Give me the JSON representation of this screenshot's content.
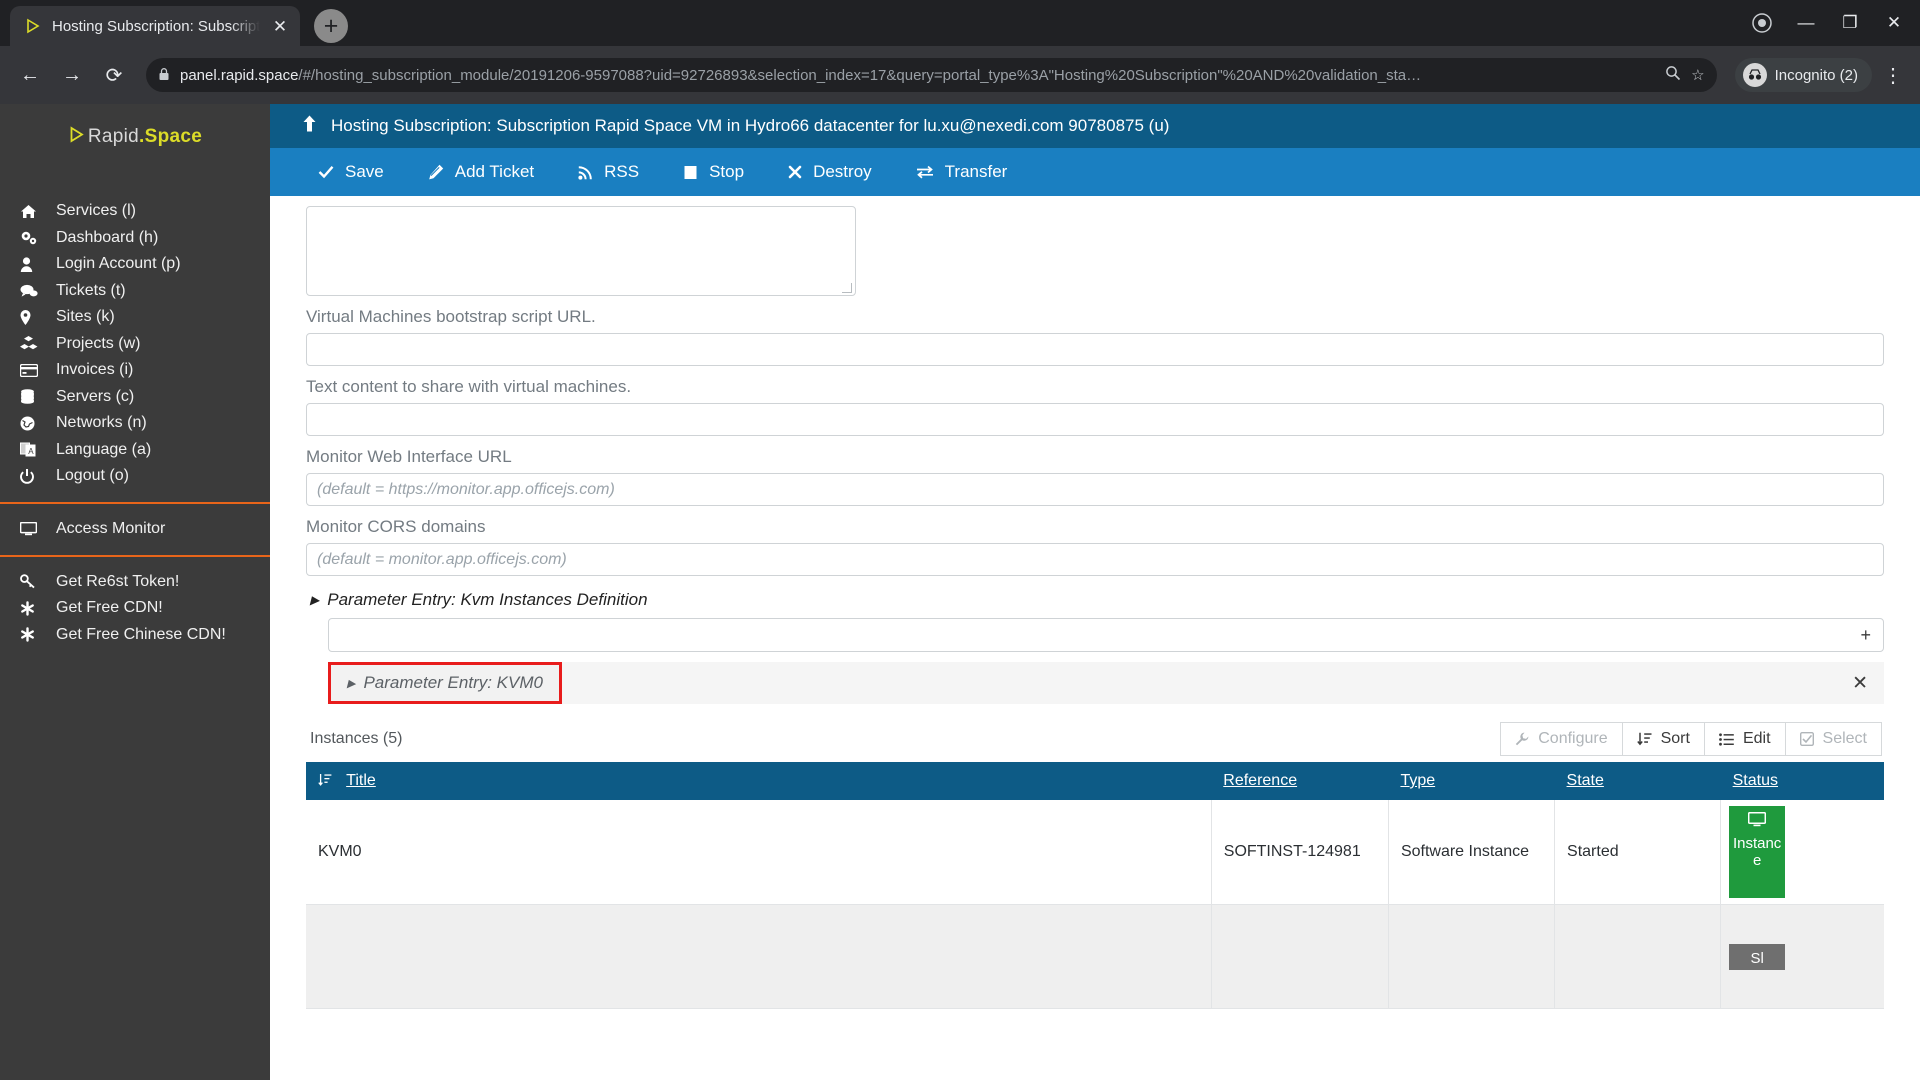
{
  "browser": {
    "tab": {
      "title": "Hosting Subscription: Subscripti",
      "favicon_icon": "rapidspace-play-icon",
      "close_icon": "close-icon"
    },
    "new_tab_label": "+",
    "nav": {
      "back_icon": "back-arrow-icon",
      "forward_icon": "forward-arrow-icon",
      "reload_icon": "reload-icon"
    },
    "omnibox": {
      "lock_icon": "lock-icon",
      "url_host": "panel.rapid.space",
      "url_path": "/#/hosting_subscription_module/20191206-9597088?uid=92726893&selection_index=17&query=portal_type%3A\"Hosting%20Subscription\"%20AND%20validation_sta…",
      "zoom_icon": "zoom-icon",
      "bookmark_icon": "star-icon"
    },
    "incognito": {
      "label": "Incognito (2)",
      "avatar_icon": "incognito-avatar-icon"
    },
    "menu_icon": "kebab-menu-icon",
    "window_controls": {
      "record_icon": "record-circle-icon",
      "minimize": "—",
      "maximize": "❐",
      "close": "✕"
    }
  },
  "sidebar": {
    "brand": {
      "triangle": "▶",
      "rapid": "Rapid",
      "dot": ".",
      "space": "Space"
    },
    "items": [
      {
        "label": "Services (l)",
        "icon": "home-icon"
      },
      {
        "label": "Dashboard (h)",
        "icon": "gears-icon"
      },
      {
        "label": "Login Account (p)",
        "icon": "user-icon"
      },
      {
        "label": "Tickets (t)",
        "icon": "comments-icon"
      },
      {
        "label": "Sites (k)",
        "icon": "map-pin-icon"
      },
      {
        "label": "Projects (w)",
        "icon": "cubes-icon"
      },
      {
        "label": "Invoices (i)",
        "icon": "credit-card-icon"
      },
      {
        "label": "Servers (c)",
        "icon": "database-icon"
      },
      {
        "label": "Networks (n)",
        "icon": "globe-icon"
      },
      {
        "label": "Language (a)",
        "icon": "language-icon"
      },
      {
        "label": "Logout (o)",
        "icon": "power-icon"
      }
    ],
    "group2": [
      {
        "label": "Access Monitor",
        "icon": "monitor-icon"
      }
    ],
    "group3": [
      {
        "label": "Get Re6st Token!",
        "icon": "key-icon"
      },
      {
        "label": "Get Free CDN!",
        "icon": "asterisk-icon"
      },
      {
        "label": "Get Free Chinese CDN!",
        "icon": "asterisk-icon"
      }
    ],
    "accent_color": "#e8651a",
    "background_color": "#3b3b3b"
  },
  "app": {
    "header": {
      "up_icon": "arrow-up-icon",
      "title": "Hosting Subscription: Subscription Rapid Space VM in Hydro66 datacenter for lu.xu@nexedi.com 90780875 (u)",
      "background_color": "#0d5b86"
    },
    "toolbar": {
      "background_color": "#1a7fc1",
      "buttons": [
        {
          "label": "Save",
          "icon": "check-icon"
        },
        {
          "label": "Add Ticket",
          "icon": "ticket-icon"
        },
        {
          "label": "RSS",
          "icon": "rss-icon"
        },
        {
          "label": "Stop",
          "icon": "stop-square-icon"
        },
        {
          "label": "Destroy",
          "icon": "x-mark-icon"
        },
        {
          "label": "Transfer",
          "icon": "transfer-arrows-icon"
        }
      ]
    }
  },
  "form": {
    "fields": [
      {
        "label": "Virtual Machines bootstrap script URL.",
        "value": "",
        "placeholder": ""
      },
      {
        "label": "Text content to share with virtual machines.",
        "value": "",
        "placeholder": ""
      },
      {
        "label": "Monitor Web Interface URL",
        "value": "",
        "placeholder": "(default = https://monitor.app.officejs.com)"
      },
      {
        "label": "Monitor CORS domains",
        "value": "",
        "placeholder": "(default = monitor.app.officejs.com)"
      }
    ],
    "parameter_section": {
      "caret": "▶",
      "title": "Parameter Entry: Kvm Instances Definition",
      "add_label": "+",
      "entry": {
        "caret": "▶",
        "label": "Parameter Entry: KVM0",
        "close_icon": "close-icon",
        "highlight_color": "#e81c1c"
      }
    }
  },
  "instances": {
    "title": "Instances (5)",
    "actions": [
      {
        "label": "Configure",
        "icon": "wrench-icon",
        "disabled": true
      },
      {
        "label": "Sort",
        "icon": "sort-icon",
        "disabled": false
      },
      {
        "label": "Edit",
        "icon": "list-icon",
        "disabled": false
      },
      {
        "label": "Select",
        "icon": "checkbox-icon",
        "disabled": true
      }
    ],
    "columns": [
      "Title",
      "Reference",
      "Type",
      "State",
      "Status"
    ],
    "sort_icon": "sort-amount-icon",
    "rows": [
      {
        "title": "KVM0",
        "reference": "SOFTINST-124981",
        "type": "Software Instance",
        "state": "Started",
        "status": "Instance",
        "status_icon": "monitor-icon",
        "status_color": "#1f9a3d"
      },
      {
        "title": "",
        "reference": "",
        "type": "",
        "state": "",
        "status": "Sl",
        "status_icon": "",
        "status_color": "#6f6f6f"
      }
    ]
  }
}
